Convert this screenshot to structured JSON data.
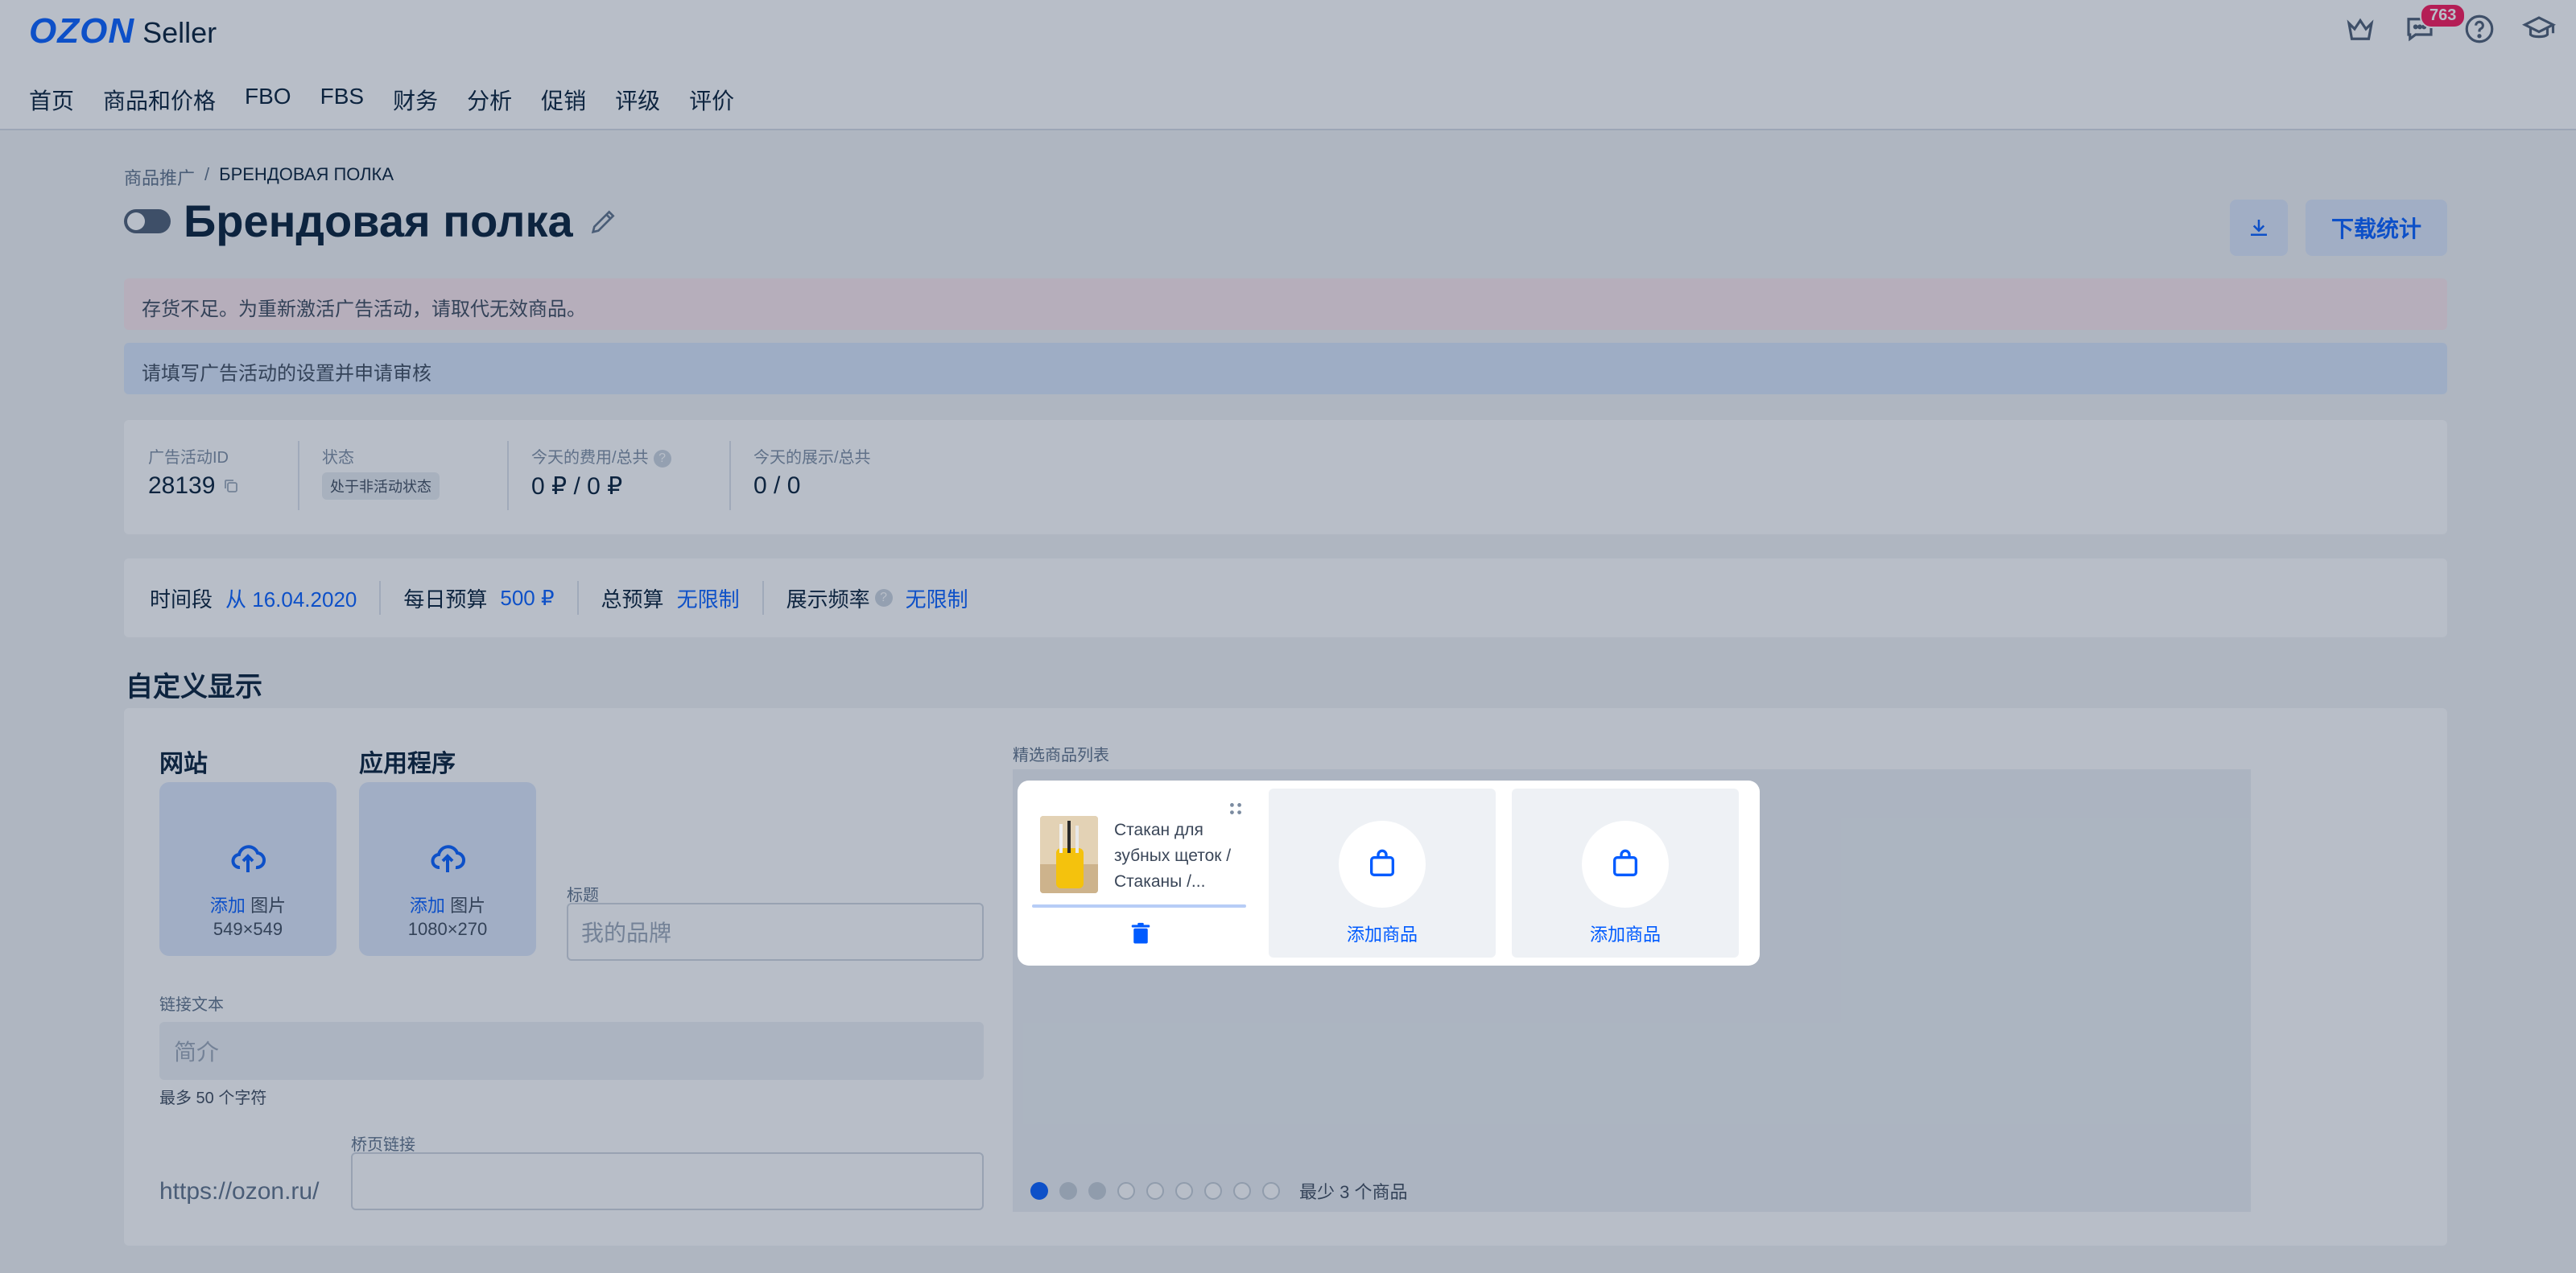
{
  "header": {
    "logo_brand": "OZON",
    "logo_product": "Seller",
    "messages_badge": "763",
    "nav": [
      "首页",
      "商品和价格",
      "FBO",
      "FBS",
      "财务",
      "分析",
      "促销",
      "评级",
      "评价"
    ]
  },
  "breadcrumb": {
    "parent": "商品推广",
    "separator": "/",
    "current": "БРЕНДОВАЯ ПОЛКА"
  },
  "page": {
    "title": "Брендовая полка",
    "download_stats_label": "下载统计"
  },
  "alerts": {
    "stock_warning": "存货不足。为重新激活广告活动，请取代无效商品。",
    "fill_settings": "请填写广告活动的设置并申请审核"
  },
  "stats": {
    "campaign_id_label": "广告活动ID",
    "campaign_id": "28139",
    "status_label": "状态",
    "status_value": "处于非活动状态",
    "cost_label": "今天的费用/总共",
    "cost_value": "0 ₽ / 0 ₽",
    "impressions_label": "今天的展示/总共",
    "impressions_value": "0 / 0"
  },
  "settings": {
    "period_label": "时间段",
    "period_value": "从 16.04.2020",
    "daily_budget_label": "每日预算",
    "daily_budget_value": "500 ₽",
    "total_budget_label": "总预算",
    "total_budget_value": "无限制",
    "frequency_label": "展示频率",
    "frequency_value": "无限制"
  },
  "custom_display": {
    "section_title": "自定义显示",
    "website_title": "网站",
    "app_title": "应用程序",
    "add_label": "添加",
    "image_label": "图片",
    "website_size": "549×549",
    "app_size": "1080×270",
    "heading_label": "标题",
    "heading_placeholder": "我的品牌",
    "link_text_label": "链接文本",
    "link_text_placeholder": "简介",
    "link_text_hint": "最多 50 个字符",
    "landing_label": "桥页链接",
    "url_prefix": "https://ozon.ru/",
    "landing_value": ""
  },
  "products": {
    "label": "精选商品列表",
    "item_name": "Стакан для зубных щеток / Стаканы /...",
    "add_product_label": "添加商品",
    "min_hint": "最少 3 个商品",
    "pager_total": 9,
    "pager_active": 1,
    "pager_filled": 2
  },
  "colors": {
    "accent": "#005bff",
    "badge": "#f91155",
    "overlay": "rgba(38,58,88,0.33)"
  }
}
